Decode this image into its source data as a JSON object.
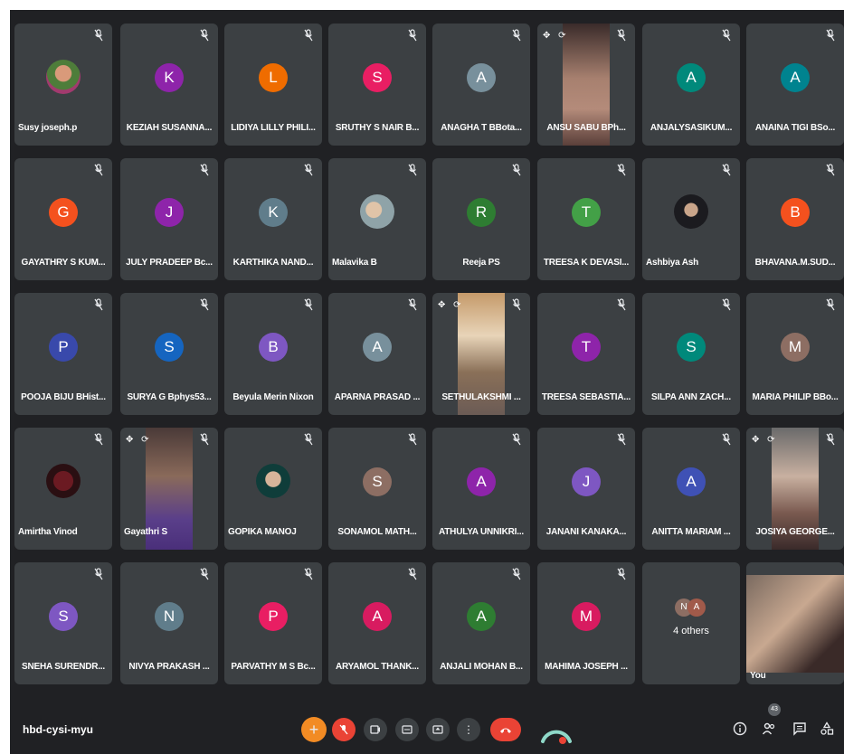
{
  "meeting": {
    "code": "hbd-cysi-myu"
  },
  "participants_count": "43",
  "others_label": "4 others",
  "others_initials": [
    "N",
    "A"
  ],
  "tiles": [
    {
      "name": "Susy joseph.p",
      "kind": "photo"
    },
    {
      "name": "KEZIAH SUSANNA...",
      "kind": "avatar",
      "initial": "K",
      "color": "#8e24aa"
    },
    {
      "name": "LIDIYA LILLY PHILI...",
      "kind": "avatar",
      "initial": "L",
      "color": "#ef6c00"
    },
    {
      "name": "SRUTHY S NAIR B...",
      "kind": "avatar",
      "initial": "S",
      "color": "#e91e63"
    },
    {
      "name": "ANAGHA T BBota...",
      "kind": "avatar",
      "initial": "A",
      "color": "#78909c"
    },
    {
      "name": "ANSU SABU BPh...",
      "kind": "video"
    },
    {
      "name": "ANJALYSASIKUM...",
      "kind": "avatar",
      "initial": "A",
      "color": "#00897b"
    },
    {
      "name": "ANAINA TIGI BSo...",
      "kind": "avatar",
      "initial": "A",
      "color": "#00838f"
    },
    {
      "name": "GAYATHRY S KUM...",
      "kind": "avatar",
      "initial": "G",
      "color": "#f4511e"
    },
    {
      "name": "JULY PRADEEP Bc...",
      "kind": "avatar",
      "initial": "J",
      "color": "#8e24aa"
    },
    {
      "name": "KARTHIKA NAND...",
      "kind": "avatar",
      "initial": "K",
      "color": "#607d8b"
    },
    {
      "name": "Malavika B",
      "kind": "photo"
    },
    {
      "name": "Reeja PS",
      "kind": "avatar",
      "initial": "R",
      "color": "#2e7d32"
    },
    {
      "name": "TREESA K DEVASI...",
      "kind": "avatar",
      "initial": "T",
      "color": "#43a047"
    },
    {
      "name": "Ashbiya Ash",
      "kind": "photo"
    },
    {
      "name": "BHAVANA.M.SUD...",
      "kind": "avatar",
      "initial": "B",
      "color": "#f4511e"
    },
    {
      "name": "POOJA BIJU BHist...",
      "kind": "avatar",
      "initial": "P",
      "color": "#3949ab"
    },
    {
      "name": "SURYA G Bphys53...",
      "kind": "avatar",
      "initial": "S",
      "color": "#1565c0"
    },
    {
      "name": "Beyula Merin Nixon",
      "kind": "avatar",
      "initial": "B",
      "color": "#7e57c2"
    },
    {
      "name": "APARNA PRASAD ...",
      "kind": "avatar",
      "initial": "A",
      "color": "#78909c"
    },
    {
      "name": "SETHULAKSHMI ...",
      "kind": "video"
    },
    {
      "name": "TREESA SEBASTIA...",
      "kind": "avatar",
      "initial": "T",
      "color": "#8e24aa"
    },
    {
      "name": "SILPA ANN ZACH...",
      "kind": "avatar",
      "initial": "S",
      "color": "#00897b"
    },
    {
      "name": "MARIA PHILIP BBo...",
      "kind": "avatar",
      "initial": "M",
      "color": "#8d6e63"
    },
    {
      "name": "Amirtha Vinod",
      "kind": "photo"
    },
    {
      "name": "Gayathri S",
      "kind": "video"
    },
    {
      "name": "GOPIKA MANOJ",
      "kind": "photo"
    },
    {
      "name": "SONAMOL MATH...",
      "kind": "avatar",
      "initial": "S",
      "color": "#8d6e63"
    },
    {
      "name": "ATHULYA UNNIKRI...",
      "kind": "avatar",
      "initial": "A",
      "color": "#8e24aa"
    },
    {
      "name": "JANANI KANAKA...",
      "kind": "avatar",
      "initial": "J",
      "color": "#7e57c2"
    },
    {
      "name": "ANITTA MARIAM ...",
      "kind": "avatar",
      "initial": "A",
      "color": "#3f51b5"
    },
    {
      "name": "JOSIYA GEORGE...",
      "kind": "video"
    },
    {
      "name": "SNEHA SURENDR...",
      "kind": "avatar",
      "initial": "S",
      "color": "#7e57c2"
    },
    {
      "name": "NIVYA PRAKASH ...",
      "kind": "avatar",
      "initial": "N",
      "color": "#607d8b"
    },
    {
      "name": "PARVATHY M S Bc...",
      "kind": "avatar",
      "initial": "P",
      "color": "#e91e63"
    },
    {
      "name": "ARYAMOL THANK...",
      "kind": "avatar",
      "initial": "A",
      "color": "#d81b60"
    },
    {
      "name": "ANJALI MOHAN B...",
      "kind": "avatar",
      "initial": "A",
      "color": "#2e7d32"
    },
    {
      "name": "MAHIMA JOSEPH ...",
      "kind": "avatar",
      "initial": "M",
      "color": "#d81b60"
    },
    {
      "name": "",
      "kind": "others"
    },
    {
      "name": "You",
      "kind": "self"
    }
  ],
  "toolbar": {
    "raise_icon": "hand-icon",
    "mic_icon": "mic-off-icon",
    "captions_icon": "captions-icon",
    "layout_icon": "layout-icon",
    "present_icon": "present-icon",
    "more_icon": "more-vert-icon",
    "end_icon": "phone-hangup-icon"
  }
}
